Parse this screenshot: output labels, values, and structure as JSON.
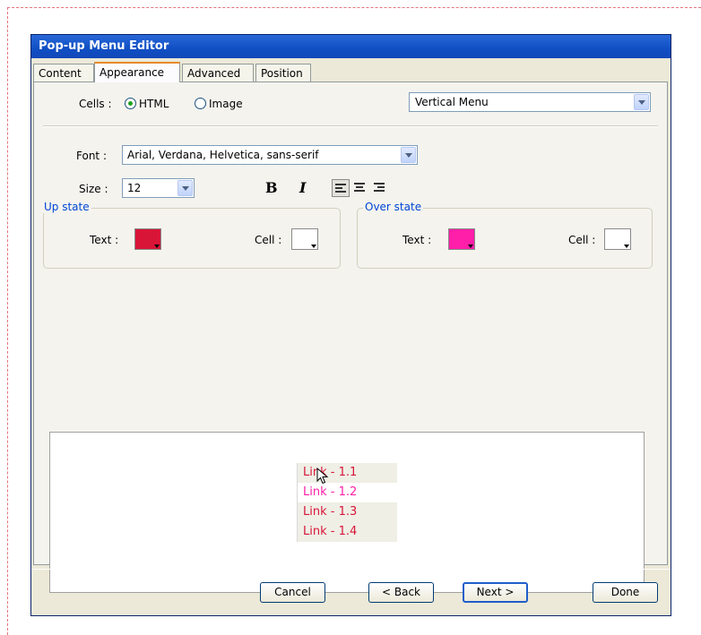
{
  "window": {
    "title": "Pop-up Menu Editor"
  },
  "tabs": [
    {
      "label": "Content",
      "active": false
    },
    {
      "label": "Appearance",
      "active": true
    },
    {
      "label": "Advanced",
      "active": false
    },
    {
      "label": "Position",
      "active": false
    }
  ],
  "cells": {
    "label": "Cells :",
    "options": [
      {
        "label": "HTML",
        "selected": true
      },
      {
        "label": "Image",
        "selected": false
      }
    ],
    "orientation": "Vertical Menu"
  },
  "font": {
    "label": "Font :",
    "value": "Arial, Verdana, Helvetica, sans-serif"
  },
  "size": {
    "label": "Size :",
    "value": "12"
  },
  "format": {
    "bold": "B",
    "italic": "I",
    "alignment": "left"
  },
  "up_state": {
    "legend": "Up state",
    "text_label": "Text :",
    "text_color": "#d81537",
    "cell_label": "Cell :",
    "cell_color": "#ffffff"
  },
  "over_state": {
    "legend": "Over state",
    "text_label": "Text :",
    "text_color": "#ff1fa8",
    "cell_label": "Cell :",
    "cell_color": "#ffffff"
  },
  "preview": {
    "items": [
      {
        "label": "Link - 1.1",
        "hover": false
      },
      {
        "label": "Link - 1.2",
        "hover": true
      },
      {
        "label": "Link - 1.3",
        "hover": false
      },
      {
        "label": "Link - 1.4",
        "hover": false
      }
    ]
  },
  "buttons": {
    "cancel": "Cancel",
    "back": "< Back",
    "next": "Next >",
    "done": "Done"
  },
  "icons": {
    "radio": "radio-icon",
    "dropdown": "chevron-down-icon",
    "align_left": "align-left-icon",
    "align_center": "align-center-icon",
    "align_right": "align-right-icon",
    "cursor": "mouse-pointer-icon"
  }
}
